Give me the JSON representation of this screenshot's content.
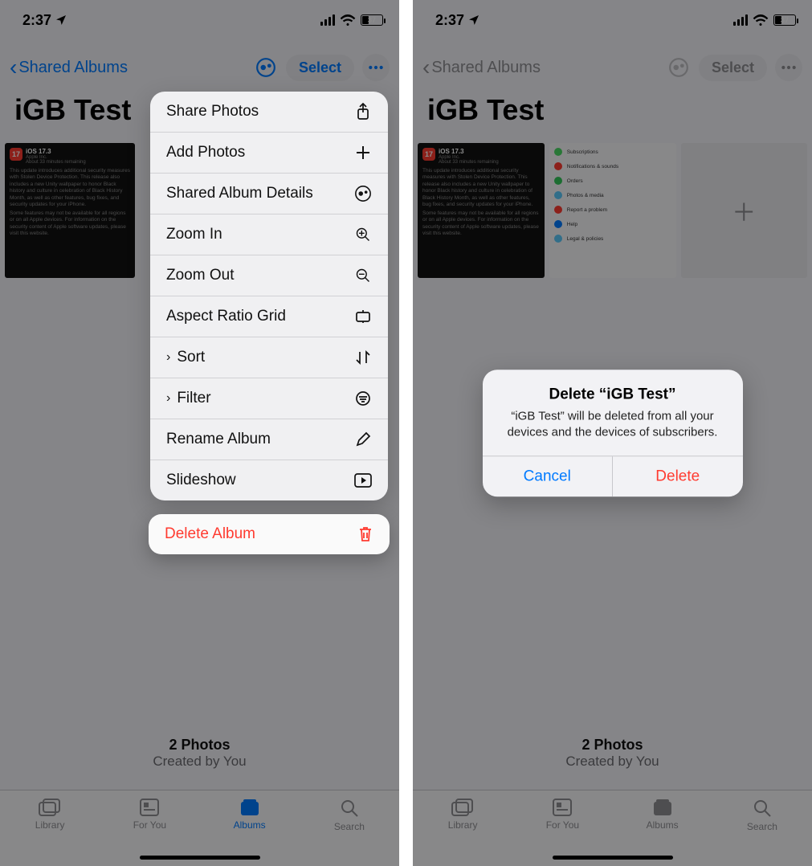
{
  "status": {
    "time": "2:37",
    "battery_pct": "37"
  },
  "nav": {
    "back_label": "Shared Albums",
    "select_label": "Select"
  },
  "album": {
    "title": "iGB Test"
  },
  "thumb1": {
    "badge": "17",
    "h1": "iOS 17.3",
    "h2": "Apple Inc.",
    "h3": "About 33 minutes remaining",
    "p1": "This update introduces additional security measures with Stolen Device Protection. This release also includes a new Unity wallpaper to honor Black history and culture in celebration of Black History Month, as well as other features, bug fixes, and security updates for your iPhone.",
    "p2": "Some features may not be available for all regions or on all Apple devices. For information on the security content of Apple software updates, please visit this website."
  },
  "thumb2": {
    "rows": [
      {
        "color": "#4cd964",
        "label": "Subscriptions"
      },
      {
        "color": "#ff3b30",
        "label": "Notifications & sounds"
      },
      {
        "color": "#34c759",
        "label": "Orders"
      },
      {
        "color": "#5ac8fa",
        "label": "Photos & media"
      },
      {
        "color": "#ff3b30",
        "label": "Report a problem"
      },
      {
        "color": "#007aff",
        "label": "Help"
      },
      {
        "color": "#5ac8fa",
        "label": "Legal & policies"
      }
    ]
  },
  "menu": {
    "share_photos": "Share Photos",
    "add_photos": "Add Photos",
    "shared_details": "Shared Album Details",
    "zoom_in": "Zoom In",
    "zoom_out": "Zoom Out",
    "aspect_grid": "Aspect Ratio Grid",
    "sort": "Sort",
    "filter": "Filter",
    "rename": "Rename Album",
    "slideshow": "Slideshow",
    "delete_album": "Delete Album"
  },
  "footer": {
    "count": "2 Photos",
    "byline": "Created by You"
  },
  "tabs": {
    "library": "Library",
    "foryou": "For You",
    "albums": "Albums",
    "search": "Search"
  },
  "alert": {
    "title": "Delete “iGB Test”",
    "message": "“iGB Test” will be deleted from all your devices and the devices of subscribers.",
    "cancel": "Cancel",
    "delete": "Delete"
  }
}
